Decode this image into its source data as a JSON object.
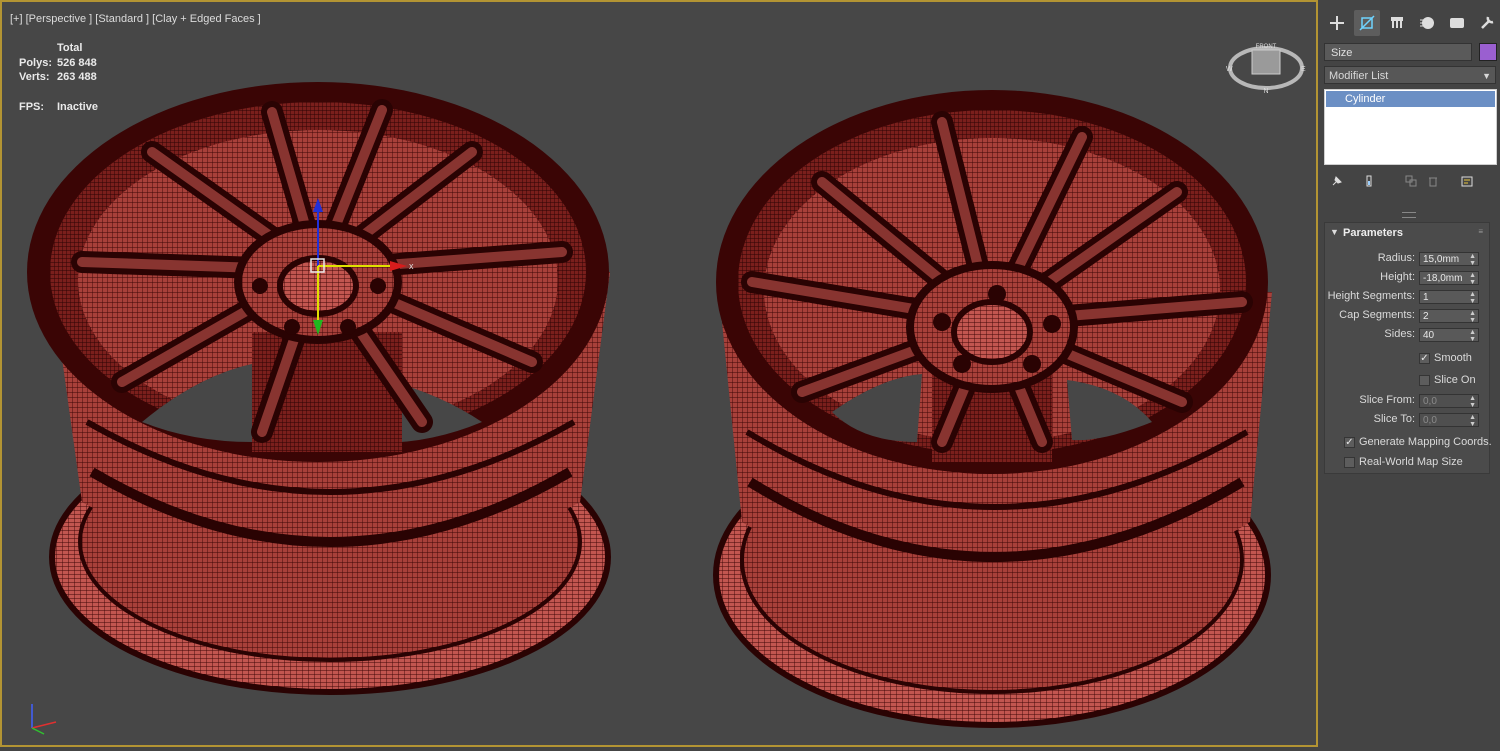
{
  "viewport": {
    "label": "[+] [Perspective ] [Standard ] [Clay + Edged Faces ]",
    "stats": {
      "header": "Total",
      "polys_label": "Polys:",
      "polys_value": "526 848",
      "verts_label": "Verts:",
      "verts_value": "263 488",
      "fps_label": "FPS:",
      "fps_value": "Inactive"
    },
    "gizmo_axis_label": "x",
    "viewcube": {
      "front_label": "FRONT",
      "n": "N",
      "w": "W",
      "e": "E"
    },
    "wheel_color": "#a53a35",
    "wireframe_color": "#3d0606"
  },
  "panel": {
    "tabs": [
      "create-icon",
      "modify-icon",
      "hierarchy-icon",
      "motion-icon",
      "display-icon",
      "utilities-icon"
    ],
    "object_name": "Size",
    "object_color": "#9a5fd0",
    "modifier_list": "Modifier List",
    "stack_items": [
      "Cylinder"
    ],
    "parameters": {
      "title": "Parameters",
      "radius_label": "Radius:",
      "radius_value": "15,0mm",
      "height_label": "Height:",
      "height_value": "-18,0mm",
      "height_segments_label": "Height Segments:",
      "height_segments_value": "1",
      "cap_segments_label": "Cap Segments:",
      "cap_segments_value": "2",
      "sides_label": "Sides:",
      "sides_value": "40",
      "smooth_label": "Smooth",
      "smooth_checked": true,
      "slice_on_label": "Slice On",
      "slice_on_checked": false,
      "slice_from_label": "Slice From:",
      "slice_from_value": "0,0",
      "slice_to_label": "Slice To:",
      "slice_to_value": "0,0",
      "gen_mapping_label": "Generate Mapping Coords.",
      "gen_mapping_checked": true,
      "real_world_label": "Real-World Map Size",
      "real_world_checked": false
    }
  }
}
